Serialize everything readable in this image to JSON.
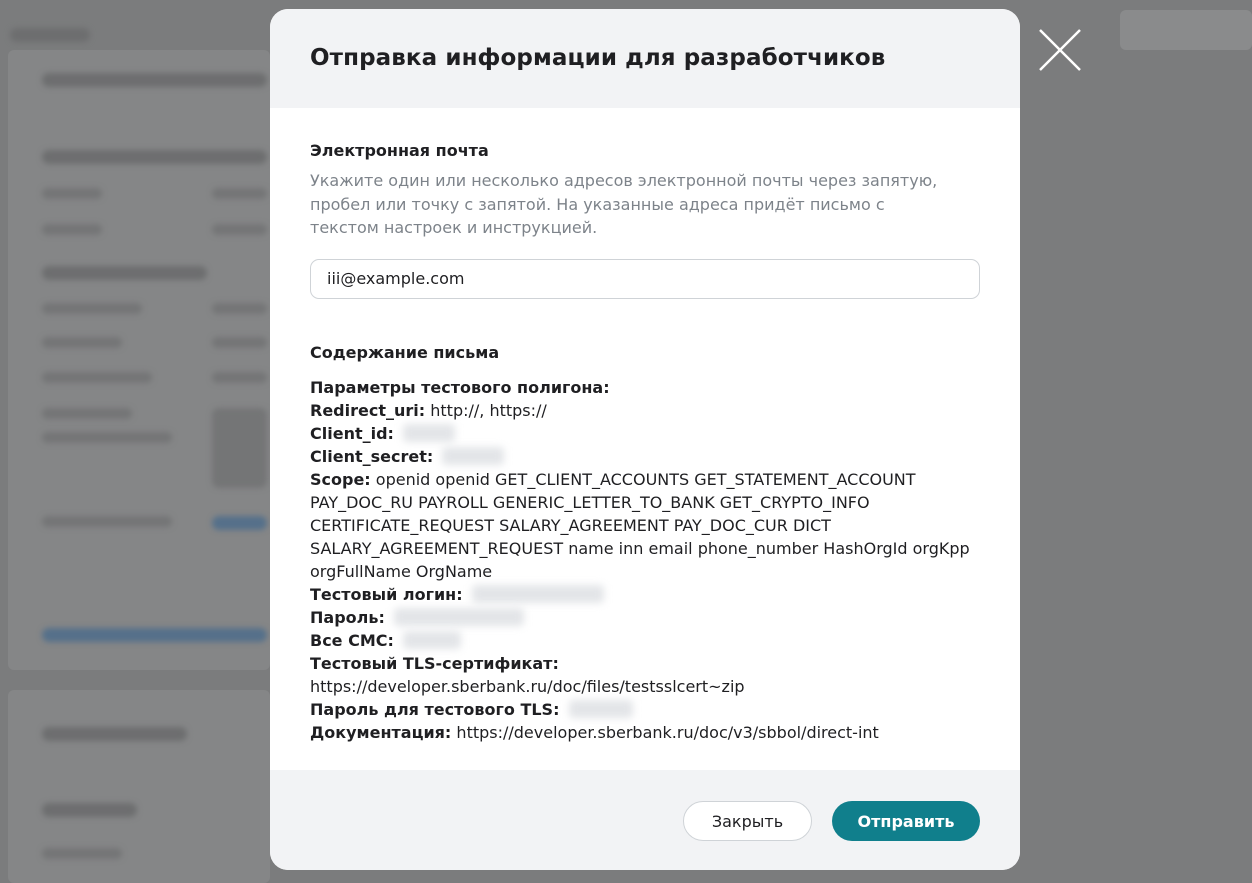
{
  "modal": {
    "title": "Отправка информации для разработчиков",
    "email_section_title": "Электронная почта",
    "email_hint": "Укажите один или несколько адресов электронной почты через запятую, пробел или точку с запятой. На указанные адреса придёт письмо с текстом настроек и инструкцией.",
    "email_value": "iii@example.com",
    "content_section_title": "Содержание письма",
    "letter": {
      "params_label": "Параметры тестового полигона:",
      "redirect_label": "Redirect_uri:",
      "redirect_value": "http://, https://",
      "client_id_label": "Client_id:",
      "client_secret_label": "Client_secret:",
      "scope_label": "Scope:",
      "scope_value": "openid openid GET_CLIENT_ACCOUNTS GET_STATEMENT_ACCOUNT PAY_DOC_RU PAYROLL GENERIC_LETTER_TO_BANK GET_CRYPTO_INFO CERTIFICATE_REQUEST SALARY_AGREEMENT PAY_DOC_CUR DICT SALARY_AGREEMENT_REQUEST name inn email phone_number HashOrgId orgKpp orgFullName OrgName",
      "login_label": "Тестовый логин:",
      "password_label": "Пароль:",
      "sms_label": "Все СМС:",
      "tls_cert_label": "Тестовый TLS-сертификат:",
      "tls_cert_value": "https://developer.sberbank.ru/doc/files/testsslcert~zip",
      "tls_password_label": "Пароль для тестового TLS:",
      "docs_label": "Документация:",
      "docs_value": "https://developer.sberbank.ru/doc/v3/sbbol/direct-int"
    },
    "close_button": "Закрыть",
    "send_button": "Отправить"
  },
  "icons": {
    "close": "close-icon"
  },
  "colors": {
    "accent": "#107f8c",
    "header_bg": "#f2f3f5",
    "overlay": "#7c7d7e"
  }
}
